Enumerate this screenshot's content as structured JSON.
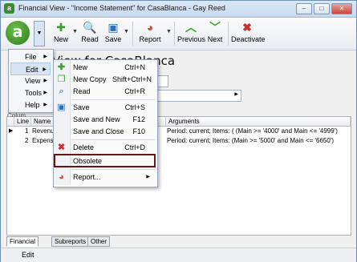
{
  "window": {
    "title": "Financial View - \"Income Statement\" for CasaBlanca - Gay Reed"
  },
  "toolbar": {
    "app_button": "a",
    "new": "New",
    "read": "Read",
    "save": "Save",
    "report": "Report",
    "previous": "Previous",
    "next": "Next",
    "deactivate": "Deactivate"
  },
  "heading": "View for CasaBlanca",
  "main_menu": {
    "items": [
      {
        "label": "File"
      },
      {
        "label": "Edit"
      },
      {
        "label": "View"
      },
      {
        "label": "Tools"
      },
      {
        "label": "Help"
      }
    ]
  },
  "edit_menu": {
    "items": [
      {
        "label": "New",
        "shortcut": "Ctrl+N"
      },
      {
        "label": "New Copy",
        "shortcut": "Shift+Ctrl+N"
      },
      {
        "label": "Read",
        "shortcut": "Ctrl+R"
      },
      {
        "label": "Save",
        "shortcut": "Ctrl+S"
      },
      {
        "label": "Save and New",
        "shortcut": "F12"
      },
      {
        "label": "Save and Close",
        "shortcut": "F10"
      },
      {
        "label": "Delete",
        "shortcut": "Ctrl+D"
      },
      {
        "label": "Obsolete",
        "shortcut": ""
      },
      {
        "label": "Report...",
        "shortcut": ""
      }
    ]
  },
  "grid": {
    "partial_label": "Colum",
    "columns": [
      "Line",
      "Name",
      "Arguments"
    ],
    "rows": [
      {
        "line": "1",
        "name": "Revenu",
        "arguments": "Period: current; Items: ( (Main >= '4000' and Main <= '4999')"
      },
      {
        "line": "2",
        "name": "Expense",
        "arguments": "Period: current; Items: (Main >= '5000' and Main <= '6650')"
      }
    ]
  },
  "tabs": [
    "Financial View",
    "Subreports",
    "Other"
  ],
  "status": {
    "mode": "Edit"
  },
  "colors": {
    "highlight_box": "#6b1414",
    "accent_green": "#2c7d1d"
  }
}
